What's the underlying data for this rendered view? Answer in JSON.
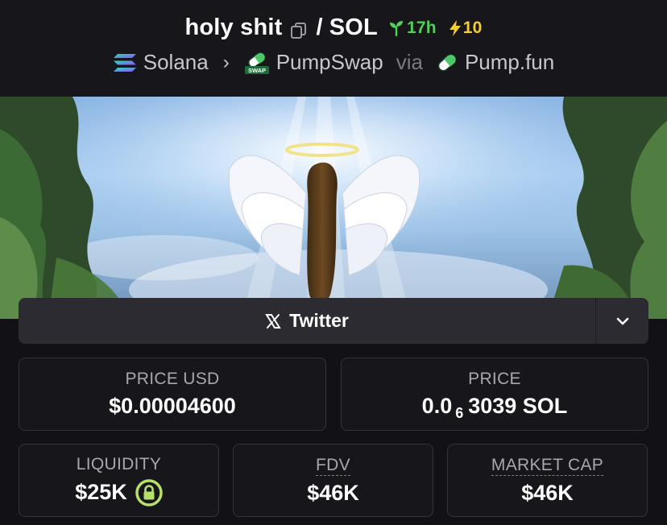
{
  "header": {
    "token_name": "holy shit",
    "separator": "/",
    "quote": "SOL",
    "age": "17h",
    "boosts": "10",
    "chain": "Solana",
    "dex": "PumpSwap",
    "via_label": "via",
    "launchpad": "Pump.fun"
  },
  "social": {
    "twitter_label": "Twitter"
  },
  "stats": {
    "price_usd_label": "PRICE USD",
    "price_usd_value": "$0.00004600",
    "price_label": "PRICE",
    "price_prefix": "0.0",
    "price_zeros": "6",
    "price_suffix": "3039 SOL",
    "liquidity_label": "LIQUIDITY",
    "liquidity_value": "$25K",
    "fdv_label": "FDV",
    "fdv_value": "$46K",
    "mcap_label": "MARKET CAP",
    "mcap_value": "$46K"
  },
  "colors": {
    "age_green": "#4fd15a",
    "boost_yellow": "#f5cf2f",
    "lock_green": "#b6e06a"
  }
}
